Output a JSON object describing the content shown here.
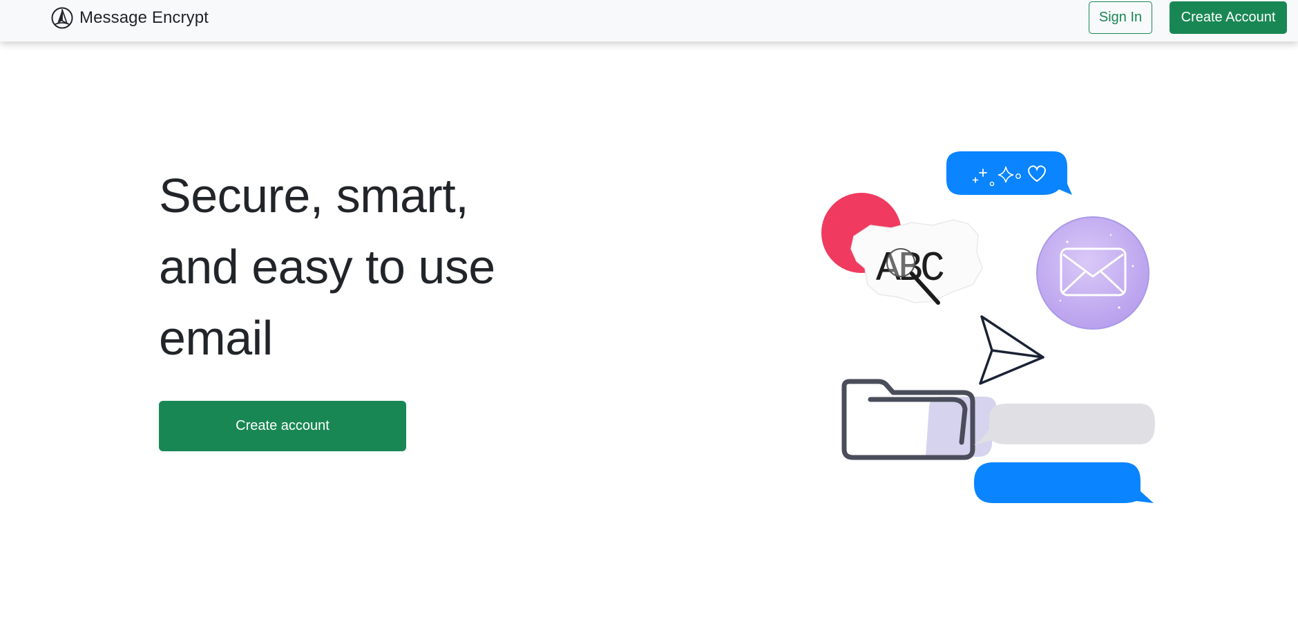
{
  "navbar": {
    "brand_name": "Message Encrypt",
    "signin_label": "Sign In",
    "create_account_label": "Create Account"
  },
  "hero": {
    "title_lines": [
      "Secure, smart,",
      "and easy to use",
      "email"
    ],
    "create_account_label": "Create account"
  },
  "illustration": {
    "note_text": "ABC",
    "icons": [
      "chat-bubble-sparkles-icon",
      "red-circle-shape",
      "torn-paper-note",
      "magnifier-icon",
      "envelope-icon",
      "paper-plane-icon",
      "folder-icon",
      "chat-bubble-gray",
      "chat-bubble-blue"
    ]
  },
  "colors": {
    "brand_green": "#198754",
    "navbar_bg": "#f8f9fa",
    "bubble_blue": "#0a84ff",
    "bubble_gray": "#e0e0e4",
    "accent_red": "#f03a5f",
    "envelope_purple": "#c7b3f2",
    "text_dark": "#212529"
  }
}
